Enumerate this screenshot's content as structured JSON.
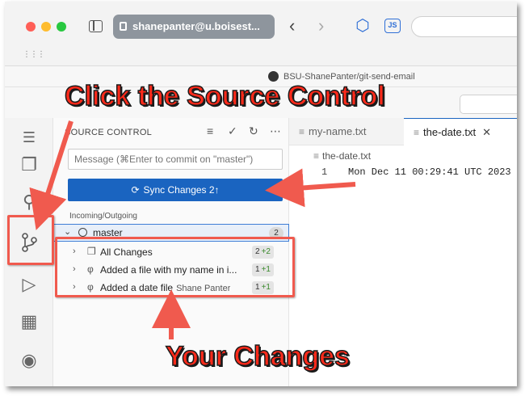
{
  "browser": {
    "address": "shanepanter@u.boisest...",
    "repo_title": "BSU-ShanePanter/git-send-email",
    "js_badge": "JS"
  },
  "scm": {
    "title": "SOURCE CONTROL",
    "message_placeholder": "Message (⌘Enter to commit on \"master\")",
    "sync_label": "Sync Changes 2↑",
    "section_header": "Incoming/Outgoing",
    "branch": {
      "name": "master",
      "count": "2"
    },
    "rows": [
      {
        "label": "All Changes",
        "author": "",
        "count": "2",
        "plus": "+2"
      },
      {
        "label": "Added a file with my name in i...",
        "author": "",
        "count": "1",
        "plus": "+1"
      },
      {
        "label": "Added a date file",
        "author": "Shane Panter",
        "count": "1",
        "plus": "+1"
      }
    ]
  },
  "editor": {
    "tabs": [
      {
        "label": "my-name.txt",
        "active": false
      },
      {
        "label": "the-date.txt",
        "active": true
      }
    ],
    "breadcrumb": "the-date.txt",
    "line_number": "1",
    "line_text": "Mon Dec 11 00:29:41 UTC 2023"
  },
  "annotations": {
    "top_callout": "Click the Source Control",
    "bottom_callout": "Your Changes",
    "accent_color": "#f05a4e"
  },
  "colors": {
    "sync_button": "#1a64c0",
    "branch_highlight": "#e8eff9"
  }
}
